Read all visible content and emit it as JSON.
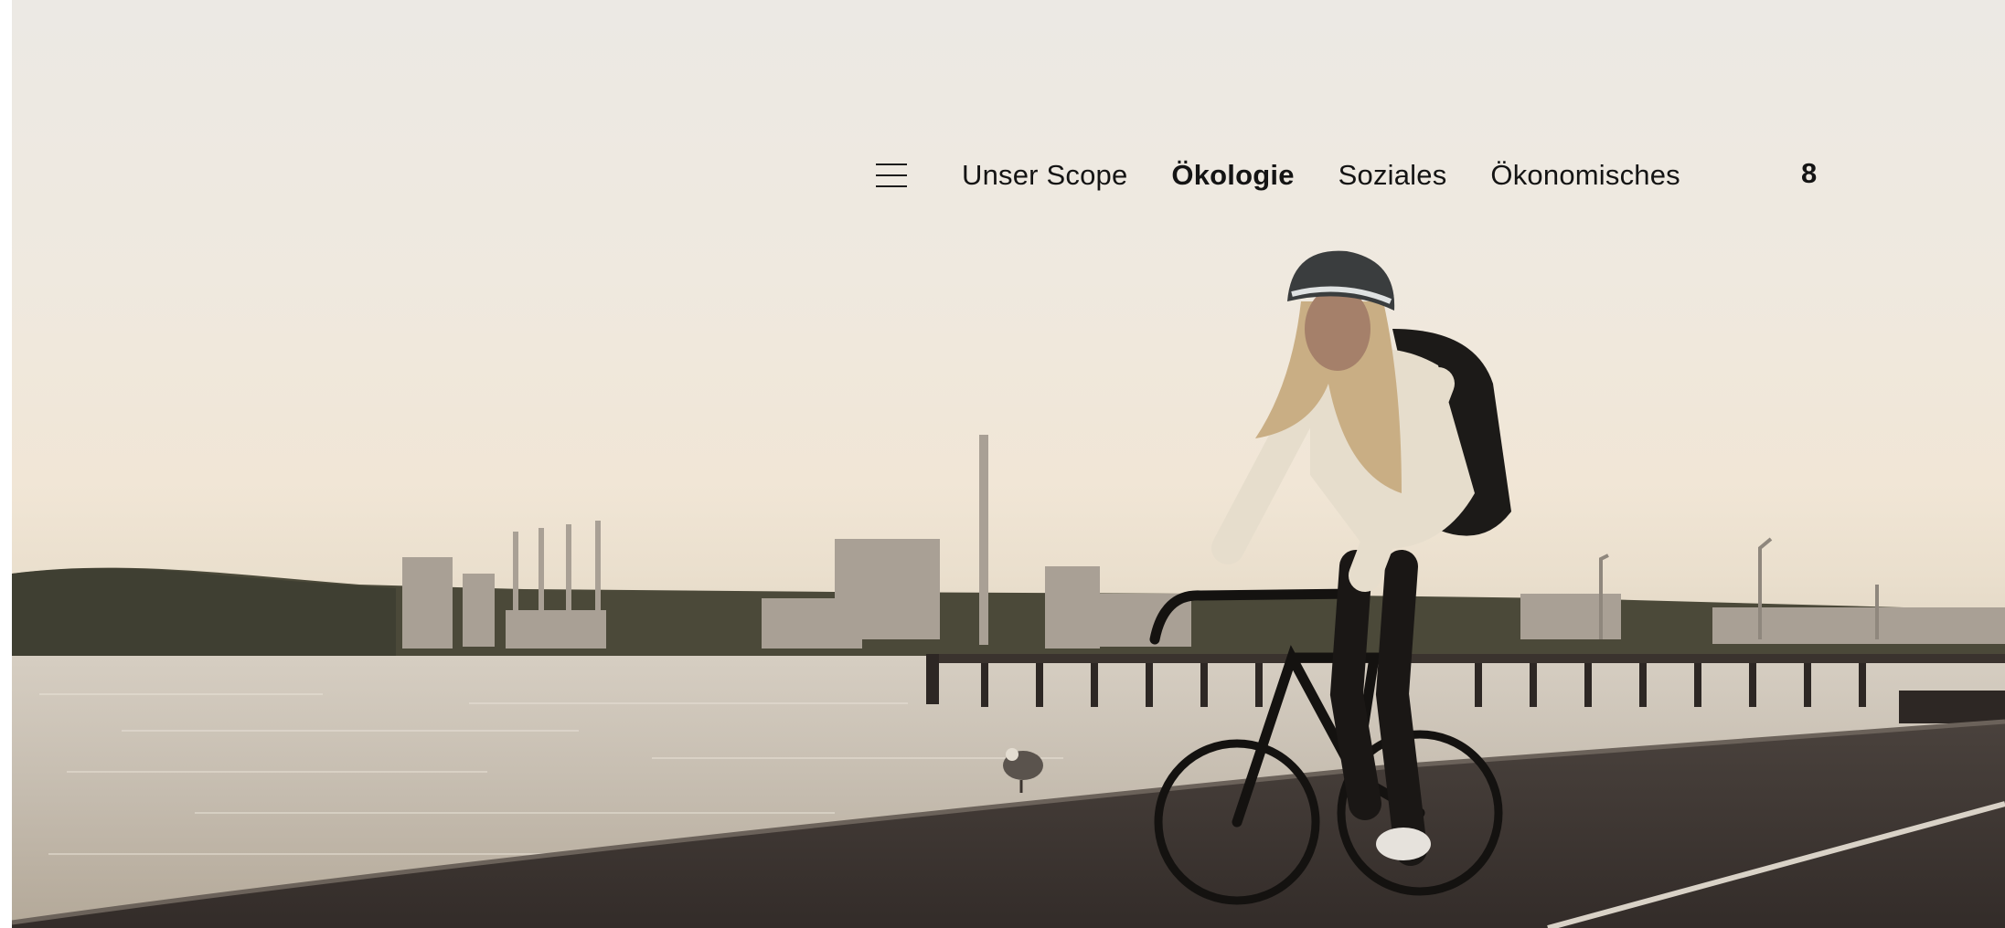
{
  "nav": {
    "menu_icon": "hamburger-menu-icon",
    "items": [
      {
        "label": "Unser Scope",
        "active": false
      },
      {
        "label": "Ökologie",
        "active": true
      },
      {
        "label": "Soziales",
        "active": false
      },
      {
        "label": "Ökonomisches",
        "active": false
      }
    ],
    "page_number": "8"
  },
  "hero": {
    "image": "woman-cycling-on-waterfront-promenade-at-sunset"
  },
  "colors": {
    "nav_text": "#141414",
    "sky": "#efe9df",
    "water": "#c9c0b2",
    "promenade": "#3d3632"
  }
}
